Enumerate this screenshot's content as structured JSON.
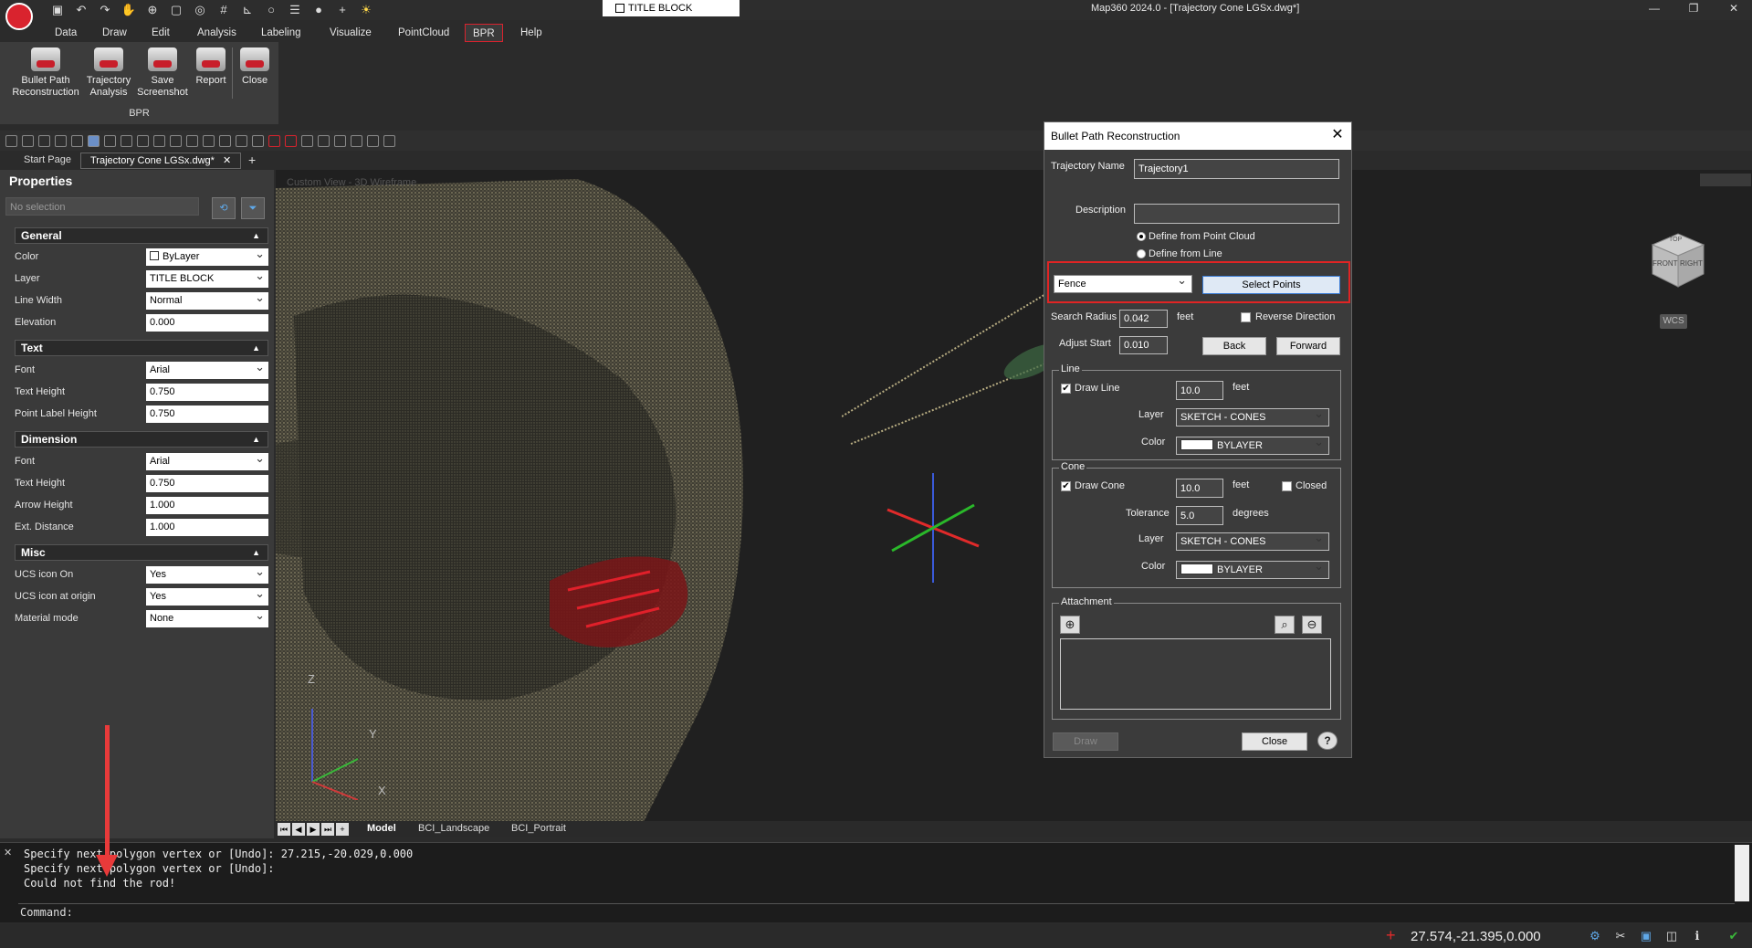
{
  "window": {
    "title": "Map360 2024.0 - [Trajectory Cone LGSx.dwg*]",
    "layer_current": "TITLE BLOCK"
  },
  "menu": [
    "Data",
    "Draw",
    "Edit",
    "Analysis",
    "Labeling",
    "Visualize",
    "PointCloud",
    "BPR",
    "Help"
  ],
  "ribbon": {
    "buttons": [
      {
        "line1": "Bullet Path",
        "line2": "Reconstruction"
      },
      {
        "line1": "Trajectory",
        "line2": "Analysis"
      },
      {
        "line1": "Save",
        "line2": "Screenshot"
      },
      {
        "line1": "Report",
        "line2": ""
      },
      {
        "line1": "Close",
        "line2": ""
      }
    ],
    "group_label": "BPR"
  },
  "doc_tabs": {
    "start": "Start Page",
    "active": "Trajectory Cone LGSx.dwg*"
  },
  "properties": {
    "title": "Properties",
    "selection": "No selection",
    "sections": {
      "general": {
        "title": "General",
        "rows": [
          {
            "label": "Color",
            "value": "ByLayer"
          },
          {
            "label": "Layer",
            "value": "TITLE BLOCK"
          },
          {
            "label": "Line Width",
            "value": "Normal"
          },
          {
            "label": "Elevation",
            "value": "0.000"
          }
        ]
      },
      "text": {
        "title": "Text",
        "rows": [
          {
            "label": "Font",
            "value": "Arial"
          },
          {
            "label": "Text Height",
            "value": "0.750"
          },
          {
            "label": "Point Label Height",
            "value": "0.750"
          }
        ]
      },
      "dimension": {
        "title": "Dimension",
        "rows": [
          {
            "label": "Font",
            "value": "Arial"
          },
          {
            "label": "Text Height",
            "value": "0.750"
          },
          {
            "label": "Arrow Height",
            "value": "1.000"
          },
          {
            "label": "Ext. Distance",
            "value": "1.000"
          }
        ]
      },
      "misc": {
        "title": "Misc",
        "rows": [
          {
            "label": "UCS icon On",
            "value": "Yes"
          },
          {
            "label": "UCS icon at origin",
            "value": "Yes"
          },
          {
            "label": "Material mode",
            "value": "None"
          }
        ]
      }
    }
  },
  "viewport": {
    "label": "Custom View - 3D Wireframe",
    "viewcube": {
      "face1": "FRONT",
      "face2": "RIGHT",
      "top": "TOP"
    },
    "wcs": "WCS",
    "axes": {
      "z": "Z",
      "y": "Y",
      "x": "X"
    }
  },
  "layout_tabs": [
    "Model",
    "BCI_Landscape",
    "BCI_Portrait"
  ],
  "command": {
    "history": [
      "Specify next polygon vertex or [Undo]: 27.215,-20.029,0.000",
      "Specify next polygon vertex or [Undo]:",
      "Could not find the rod!"
    ],
    "prompt": "Command:"
  },
  "status": {
    "coords": "27.574,-21.395,0.000"
  },
  "dialog": {
    "title": "Bullet Path Reconstruction",
    "trajectory_name_label": "Trajectory Name",
    "trajectory_name": "Trajectory1",
    "description_label": "Description",
    "description": "",
    "radio_point_cloud": "Define from Point Cloud",
    "radio_line": "Define from Line",
    "selection_mode": "Fence",
    "select_points": "Select Points",
    "search_radius_label": "Search Radius",
    "search_radius": "0.042",
    "unit_feet": "feet",
    "reverse_direction": "Reverse Direction",
    "adjust_start_label": "Adjust Start",
    "adjust_start": "0.010",
    "back": "Back",
    "forward": "Forward",
    "line_group": {
      "title": "Line",
      "draw_line": "Draw Line",
      "length": "10.0",
      "layer_label": "Layer",
      "layer": "SKETCH - CONES",
      "color_label": "Color",
      "color": "BYLAYER"
    },
    "cone_group": {
      "title": "Cone",
      "draw_cone": "Draw Cone",
      "length": "10.0",
      "closed": "Closed",
      "tolerance_label": "Tolerance",
      "tolerance": "5.0",
      "degrees": "degrees",
      "layer_label": "Layer",
      "layer": "SKETCH - CONES",
      "color_label": "Color",
      "color": "BYLAYER"
    },
    "attachment_title": "Attachment",
    "draw": "Draw",
    "close": "Close",
    "help": "?"
  },
  "colors": {
    "accent": "#d9232e",
    "highlight": "#e02424",
    "annotation_arrow": "#e83a3a"
  }
}
